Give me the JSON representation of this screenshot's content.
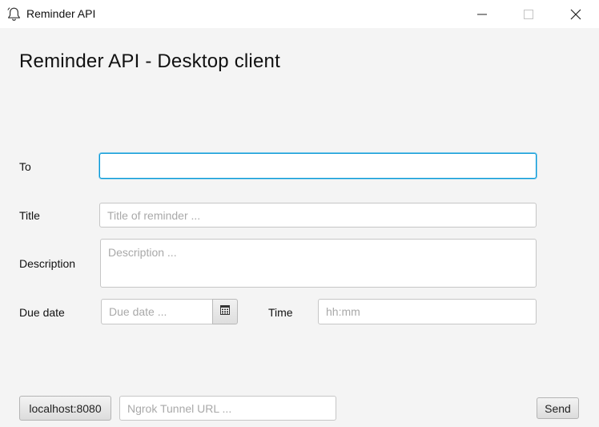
{
  "window": {
    "title": "Reminder API",
    "icon": "bell-icon",
    "controls": [
      "minimize-icon",
      "maximize-icon",
      "close-icon"
    ]
  },
  "page": {
    "title": "Reminder API - Desktop client"
  },
  "form": {
    "to": {
      "label": "To",
      "value": "",
      "placeholder": ""
    },
    "title": {
      "label": "Title",
      "value": "",
      "placeholder": "Title of reminder ..."
    },
    "description": {
      "label": "Description",
      "value": "",
      "placeholder": "Description ..."
    },
    "due_date": {
      "label": "Due date",
      "value": "",
      "placeholder": "Due date ...",
      "picker_icon": "calendar-icon"
    },
    "time": {
      "label": "Time",
      "value": "",
      "placeholder": "hh:mm"
    }
  },
  "footer": {
    "server_button": "localhost:8080",
    "ngrok": {
      "value": "",
      "placeholder": "Ngrok Tunnel URL ..."
    },
    "send_button": "Send"
  },
  "colors": {
    "background": "#f4f4f4",
    "focus_border": "#0496d6",
    "placeholder": "#a9a9a9"
  }
}
